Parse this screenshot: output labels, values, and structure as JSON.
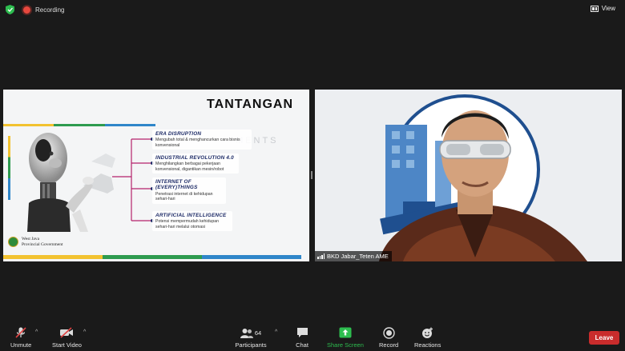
{
  "top_bar": {
    "recording_label": "Recording",
    "view_label": "View"
  },
  "slide": {
    "title": "TANTANGAN",
    "watermark": "MENTS",
    "items": [
      {
        "heading": "ERA DISRUPTION",
        "text": "Mengubah total & menghancurkan  cara bisnis konvensional"
      },
      {
        "heading": "INDUSTRIAL REVOLUTION 4.0",
        "text": "Menghilangkan berbagai pekerjaan konvensional, digantikan mesin/robot"
      },
      {
        "heading": "INTERNET OF (EVERY)THINGS",
        "text": "Penetrasi internet di kehidupan sehari-hari"
      },
      {
        "heading": "ARTIFICIAL INTELLIGENCE",
        "text": "Potensi mempermudah kehidupan sehari-hari melalui otomasi"
      }
    ],
    "logo_line1": "West Java",
    "logo_line2": "Provincial Government",
    "stripe_colors": [
      "#f2c230",
      "#2e9b4f",
      "#2f86c9"
    ]
  },
  "speaker": {
    "name": "BKD Jabar_Teten AME"
  },
  "toolbar": {
    "unmute": "Unmute",
    "start_video": "Start Video",
    "participants": "Participants",
    "participants_count": "64",
    "chat": "Chat",
    "share_screen": "Share Screen",
    "record": "Record",
    "reactions": "Reactions",
    "leave": "Leave"
  },
  "colors": {
    "share_green": "#2dbd4f",
    "leave_red": "#c92c2c",
    "recording_red": "#e8483e",
    "muted_red": "#e04343"
  }
}
